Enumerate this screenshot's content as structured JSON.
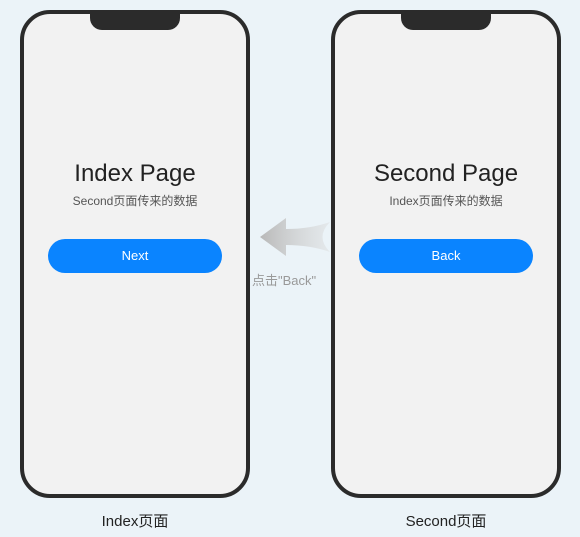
{
  "left_phone": {
    "title": "Index Page",
    "subtitle": "Second页面传来的数据",
    "button_label": "Next"
  },
  "right_phone": {
    "title": "Second Page",
    "subtitle": "Index页面传来的数据",
    "button_label": "Back"
  },
  "captions": {
    "left": "Index页面",
    "right": "Second页面"
  },
  "arrow_label": "点击\"Back\""
}
